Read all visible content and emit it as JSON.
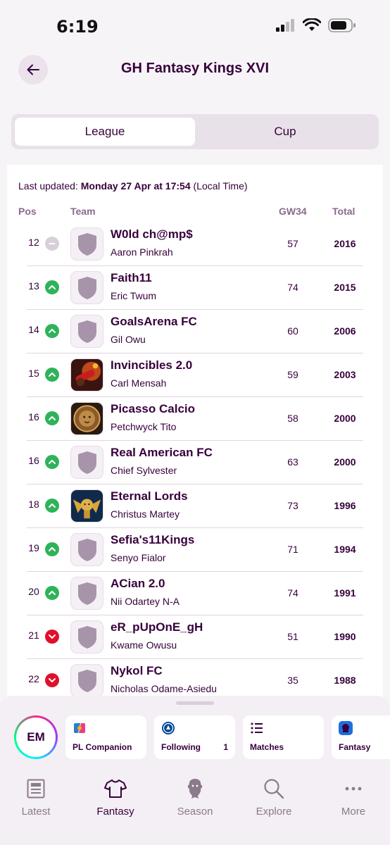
{
  "status": {
    "time": "6:19"
  },
  "header": {
    "title": "GH Fantasy Kings XVI"
  },
  "tabs": [
    {
      "label": "League",
      "active": true
    },
    {
      "label": "Cup",
      "active": false
    }
  ],
  "updated": {
    "prefix": "Last updated:",
    "datetime": "Monday 27 Apr at 17:54",
    "suffix": "(Local Time)"
  },
  "table": {
    "headers": {
      "pos": "Pos",
      "team": "Team",
      "gw": "GW34",
      "total": "Total"
    },
    "rows": [
      {
        "pos": "12",
        "movement": "same",
        "badge": "shield",
        "team": "W0ld ch@mp$",
        "manager": "Aaron Pinkrah",
        "gw": "57",
        "total": "2016"
      },
      {
        "pos": "13",
        "movement": "up",
        "badge": "shield",
        "team": "Faith11",
        "manager": "Eric Twum",
        "gw": "74",
        "total": "2015"
      },
      {
        "pos": "14",
        "movement": "up",
        "badge": "shield",
        "team": "GoalsArena FC",
        "manager": "Gil Owu",
        "gw": "60",
        "total": "2006"
      },
      {
        "pos": "15",
        "movement": "up",
        "badge": "red-cannon",
        "team": "Invincibles 2.0",
        "manager": "Carl Mensah",
        "gw": "59",
        "total": "2003"
      },
      {
        "pos": "16",
        "movement": "up",
        "badge": "lion-crest",
        "team": "Picasso Calcio",
        "manager": "Petchwyck Tito",
        "gw": "58",
        "total": "2000"
      },
      {
        "pos": "16",
        "movement": "up",
        "badge": "shield",
        "team": "Real American FC",
        "manager": "Chief Sylvester",
        "gw": "63",
        "total": "2000"
      },
      {
        "pos": "18",
        "movement": "up",
        "badge": "winged-lion",
        "team": "Eternal Lords",
        "manager": "Christus Martey",
        "gw": "73",
        "total": "1996"
      },
      {
        "pos": "19",
        "movement": "up",
        "badge": "shield",
        "team": "Sefia's11Kings",
        "manager": "Senyo Fialor",
        "gw": "71",
        "total": "1994"
      },
      {
        "pos": "20",
        "movement": "up",
        "badge": "shield",
        "team": "ACian 2.0",
        "manager": "Nii Odartey N-A",
        "gw": "74",
        "total": "1991"
      },
      {
        "pos": "21",
        "movement": "down",
        "badge": "shield",
        "team": "eR_pUpOnE_gH",
        "manager": "Kwame Owusu",
        "gw": "51",
        "total": "1990"
      },
      {
        "pos": "22",
        "movement": "down",
        "badge": "shield",
        "team": "Nykol FC",
        "manager": "Nicholas Odame-Asiedu",
        "gw": "35",
        "total": "1988"
      }
    ]
  },
  "quick_access": {
    "avatar_initials": "EM",
    "items": [
      {
        "label": "PL Companion",
        "icon": "copilot-icon"
      },
      {
        "label": "Following",
        "count": "1",
        "icon": "chelsea-crest-icon"
      },
      {
        "label": "Matches",
        "icon": "list-icon"
      },
      {
        "label": "Fantasy",
        "icon": "premier-league-icon"
      }
    ]
  },
  "nav": [
    {
      "label": "Latest",
      "icon": "news-icon"
    },
    {
      "label": "Fantasy",
      "icon": "shirt-icon",
      "active": true
    },
    {
      "label": "Season",
      "icon": "lion-icon"
    },
    {
      "label": "Explore",
      "icon": "search-icon"
    },
    {
      "label": "More",
      "icon": "more-icon"
    }
  ],
  "colors": {
    "primary": "#37003c",
    "up": "#2fb35a",
    "down": "#e0102b",
    "same": "#d8d0d9",
    "shield": "#a894aa"
  }
}
